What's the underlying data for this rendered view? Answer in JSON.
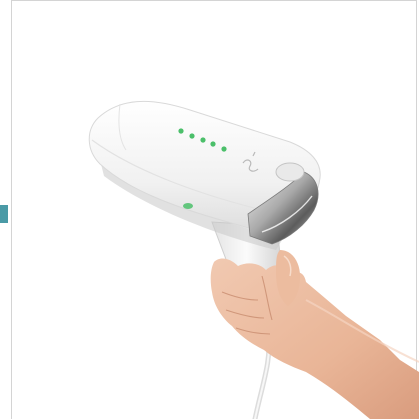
{
  "product_photo": {
    "accent_color": "#4bbf6a",
    "tab_color": "#4a9aa6",
    "device_color": "#f2f2f2",
    "indicator_dots": 5,
    "icons": [
      "device-logo-icon"
    ]
  }
}
